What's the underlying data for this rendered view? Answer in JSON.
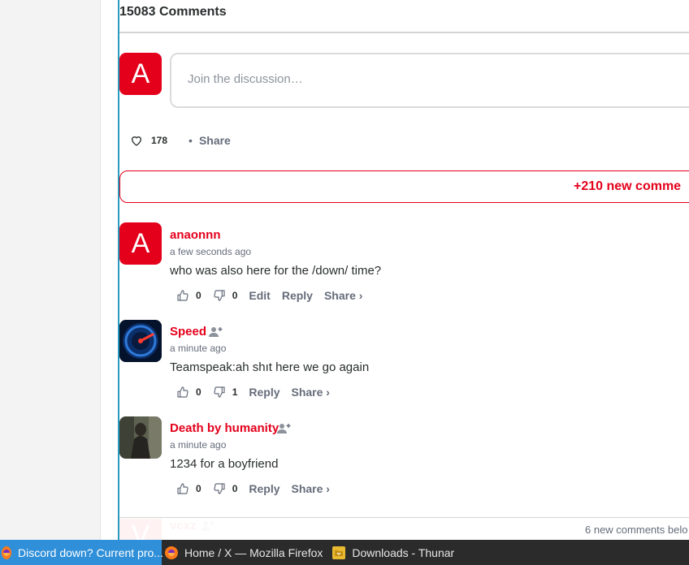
{
  "comments_count_label": "15083 Comments",
  "composer": {
    "avatar_letter": "A",
    "placeholder": "Join the discussion…"
  },
  "reactions": {
    "like_count": "178",
    "share_label": "Share"
  },
  "new_comments_banner": "+210 new comme",
  "comments": [
    {
      "author": "anaonnn",
      "avatar_letter": "A",
      "time": "a few seconds ago",
      "text": "who was also here for the /down/ time?",
      "upvotes": "0",
      "downvotes": "0",
      "actions": [
        "Edit",
        "Reply",
        "Share ›"
      ]
    },
    {
      "author": "Speed",
      "time": "a minute ago",
      "text": "Teamspeak:ah shıt here we go again",
      "upvotes": "0",
      "downvotes": "1",
      "actions": [
        "Reply",
        "Share ›"
      ]
    },
    {
      "author": "Death by humanity",
      "time": "a minute ago",
      "text": "1234 for a boyfriend",
      "upvotes": "0",
      "downvotes": "0",
      "actions": [
        "Reply",
        "Share ›"
      ]
    },
    {
      "author": "vcxz",
      "avatar_letter": "V"
    }
  ],
  "footer_new_comments": "6 new comments belo",
  "taskbar": [
    {
      "label": "Discord down? Current pro...",
      "active": true
    },
    {
      "label": "Home / X — Mozilla Firefox",
      "active": false
    },
    {
      "label": "Downloads - Thunar",
      "active": false
    }
  ],
  "colors": {
    "accent": "#e4001b",
    "left_border": "#2a9bc0",
    "taskbar_active": "#2f8fd8"
  }
}
